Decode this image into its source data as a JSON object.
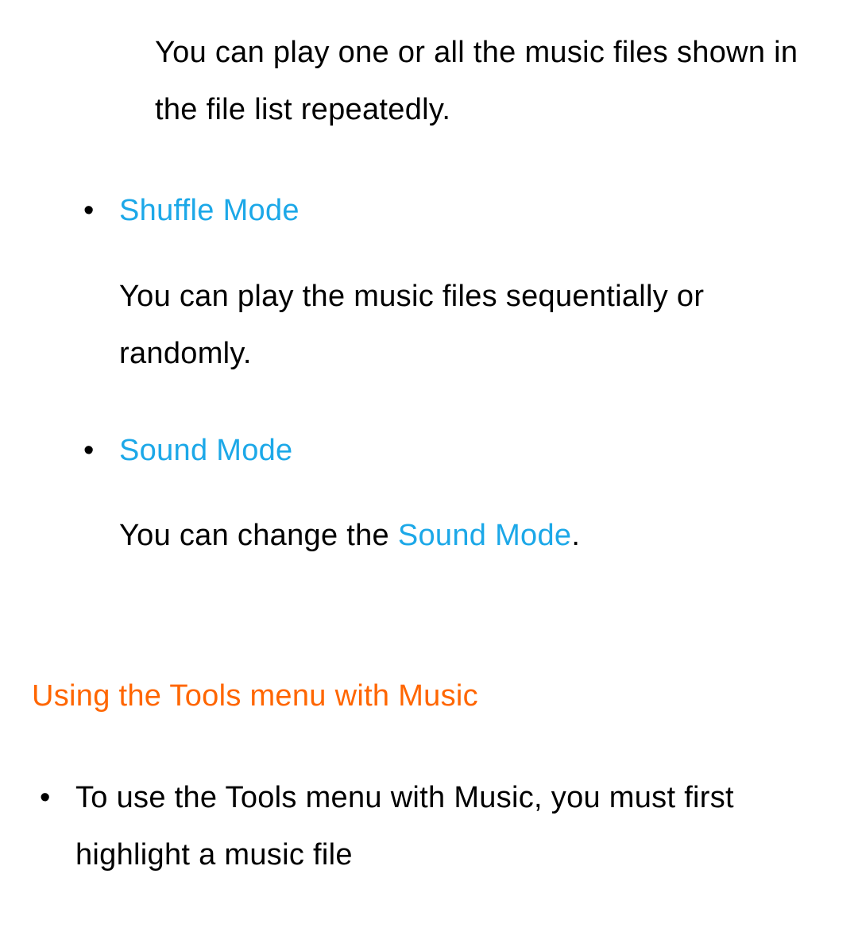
{
  "intro_desc": "You can play one or all the music files shown in the file list repeatedly.",
  "items": [
    {
      "title": "Shuffle Mode",
      "desc": "You can play the music files sequentially or randomly."
    },
    {
      "title": "Sound Mode",
      "desc_prefix": "You can change the ",
      "desc_link": "Sound Mode",
      "desc_suffix": "."
    }
  ],
  "section_heading": "Using the Tools menu with Music",
  "outer_item": "To use the Tools menu with Music, you must first highlight a music file"
}
